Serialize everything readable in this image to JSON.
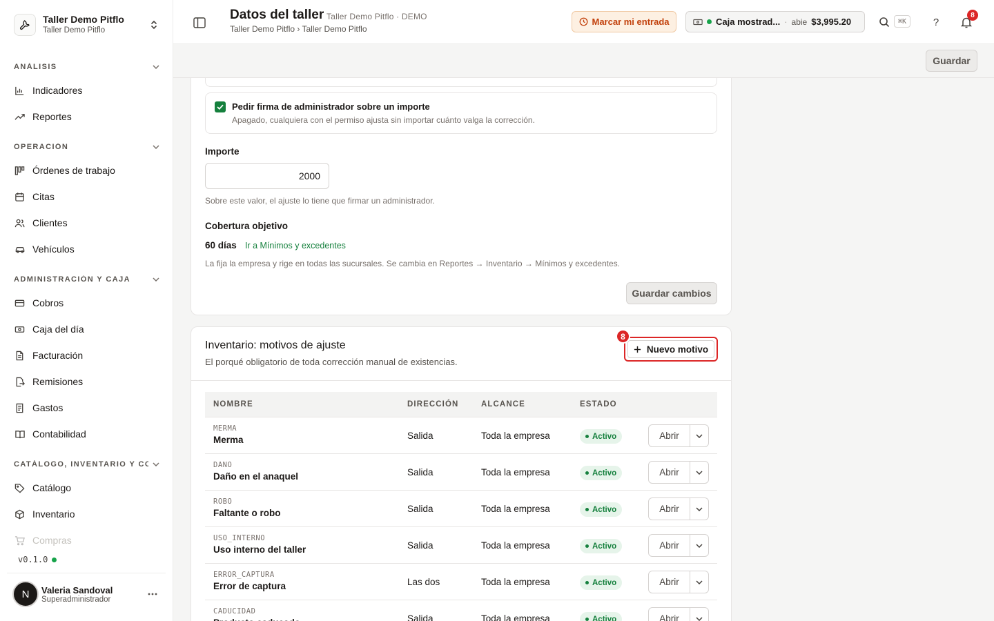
{
  "workspace": {
    "title": "Taller Demo Pitflo",
    "subtitle": "Taller Demo Pitflo"
  },
  "sidebar": {
    "sections": [
      {
        "label": "ANÁLISIS"
      },
      {
        "label": "OPERACIÓN"
      },
      {
        "label": "ADMINISTRACIÓN Y CAJA"
      },
      {
        "label": "CATÁLOGO, INVENTARIO Y CO..."
      }
    ],
    "items": [
      {
        "label": "Indicadores",
        "icon": "bar-chart-icon"
      },
      {
        "label": "Reportes",
        "icon": "trend-icon"
      },
      {
        "label": "Órdenes de trabajo",
        "icon": "kanban-icon"
      },
      {
        "label": "Citas",
        "icon": "calendar-icon"
      },
      {
        "label": "Clientes",
        "icon": "users-icon"
      },
      {
        "label": "Vehículos",
        "icon": "car-icon"
      },
      {
        "label": "Cobros",
        "icon": "card-icon"
      },
      {
        "label": "Caja del día",
        "icon": "cash-icon"
      },
      {
        "label": "Facturación",
        "icon": "file-icon"
      },
      {
        "label": "Remisiones",
        "icon": "file-export-icon"
      },
      {
        "label": "Gastos",
        "icon": "receipt-icon"
      },
      {
        "label": "Contabilidad",
        "icon": "book-icon"
      },
      {
        "label": "Catálogo",
        "icon": "tag-icon"
      },
      {
        "label": "Inventario",
        "icon": "box-icon"
      },
      {
        "label": "Compras",
        "icon": "cart-icon"
      }
    ],
    "version": "v0.1.0"
  },
  "user": {
    "initial": "N",
    "name": "Valeria Sandoval",
    "role": "Superadministrador"
  },
  "header": {
    "title": "Datos del taller",
    "subtitle": "Taller Demo Pitflo · DEMO",
    "breadcrumb": "Taller Demo Pitflo › Taller Demo Pitflo",
    "clock_in_label": "Marcar mi entrada",
    "cash": {
      "name": "Caja mostrad...",
      "separator": "·",
      "status": "abie",
      "amount": "$3,995.20"
    },
    "shortcut": "⌘K",
    "help": "?",
    "notifications_count": "8"
  },
  "toolbar": {
    "save_label": "Guardar"
  },
  "settings_card": {
    "checkbox_title": "Pedir firma de administrador sobre un importe",
    "checkbox_desc": "Apagado, cualquiera con el permiso ajusta sin importar cuánto valga la corrección.",
    "amount_label": "Importe",
    "amount_value": "2000",
    "amount_help": "Sobre este valor, el ajuste lo tiene que firmar un administrador.",
    "coverage_label": "Cobertura objetivo",
    "coverage_value": "60 días",
    "coverage_link": "Ir a Mínimos y excedentes",
    "coverage_help": "La fija la empresa y rige en todas las sucursales. Se cambia en Reportes → Inventario → Mínimos y excedentes.",
    "save_changes_label": "Guardar cambios"
  },
  "reasons_card": {
    "title": "Inventario: motivos de ajuste",
    "description": "El porqué obligatorio de toda corrección manual de existencias.",
    "new_button_label": "Nuevo motivo",
    "new_button_badge": "8",
    "columns": [
      "NOMBRE",
      "DIRECCIÓN",
      "ALCANCE",
      "ESTADO"
    ],
    "open_label": "Abrir",
    "rows": [
      {
        "code": "MERMA",
        "name": "Merma",
        "direction": "Salida",
        "scope": "Toda la empresa",
        "status": "Activo"
      },
      {
        "code": "DANO",
        "name": "Daño en el anaquel",
        "direction": "Salida",
        "scope": "Toda la empresa",
        "status": "Activo"
      },
      {
        "code": "ROBO",
        "name": "Faltante o robo",
        "direction": "Salida",
        "scope": "Toda la empresa",
        "status": "Activo"
      },
      {
        "code": "USO_INTERNO",
        "name": "Uso interno del taller",
        "direction": "Salida",
        "scope": "Toda la empresa",
        "status": "Activo"
      },
      {
        "code": "ERROR_CAPTURA",
        "name": "Error de captura",
        "direction": "Las dos",
        "scope": "Toda la empresa",
        "status": "Activo"
      },
      {
        "code": "CADUCIDAD",
        "name": "Producto caducado",
        "direction": "Salida",
        "scope": "Toda la empresa",
        "status": "Activo"
      }
    ]
  },
  "colors": {
    "accent_green": "#15803d",
    "alert_red": "#dc2626",
    "warning_orange": "#c2410c"
  }
}
